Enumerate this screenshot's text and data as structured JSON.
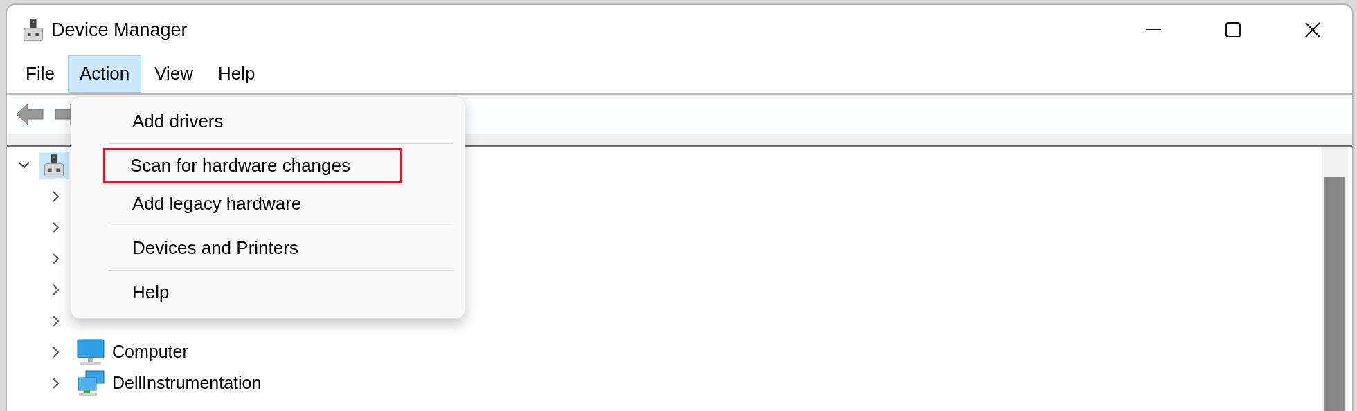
{
  "window": {
    "title": "Device Manager"
  },
  "menu_bar": [
    {
      "label": "File",
      "selected": false
    },
    {
      "label": "Action",
      "selected": true
    },
    {
      "label": "View",
      "selected": false
    },
    {
      "label": "Help",
      "selected": false
    }
  ],
  "action_menu": {
    "items": [
      {
        "label": "Add drivers",
        "highlighted": false,
        "separator_after": true
      },
      {
        "label": "Scan for hardware changes",
        "highlighted": true,
        "separator_after": false
      },
      {
        "label": "Add legacy hardware",
        "highlighted": false,
        "separator_after": true
      },
      {
        "label": "Devices and Printers",
        "highlighted": false,
        "separator_after": true
      },
      {
        "label": "Help",
        "highlighted": false,
        "separator_after": false
      }
    ]
  },
  "tree": {
    "root": {
      "expanded": true,
      "selected": true,
      "children": [
        {
          "expanded": false
        },
        {
          "expanded": false
        },
        {
          "expanded": false
        },
        {
          "expanded": false
        },
        {
          "expanded": false
        },
        {
          "label": "Computer",
          "kind": "monitor",
          "expanded": false
        },
        {
          "label": "DellInstrumentation",
          "kind": "network",
          "expanded": false
        }
      ]
    }
  }
}
